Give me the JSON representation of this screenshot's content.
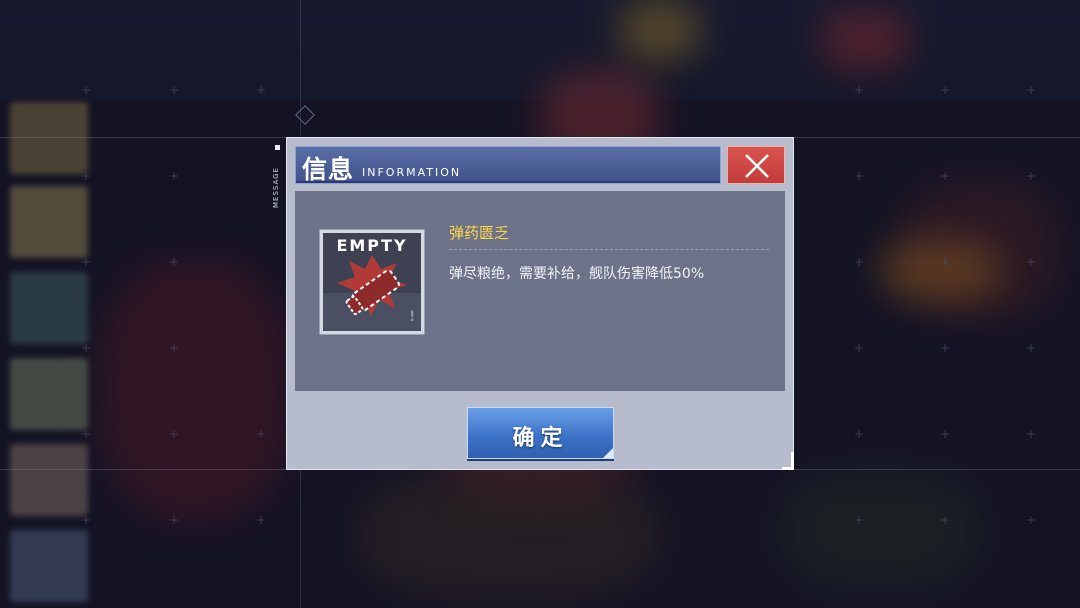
{
  "dialog": {
    "side_label": "MESSAGE",
    "title_cn": "信息",
    "title_en": "INFORMATION",
    "close_icon": "close-icon"
  },
  "item": {
    "icon_label": "EMPTY",
    "icon": "empty-ammo-icon",
    "name": "弹药匮乏",
    "description": "弹尽粮绝，需要补给，舰队伤害降低50%"
  },
  "confirm": {
    "label": "确定"
  },
  "colors": {
    "title_bar": "#4a5d98",
    "close_button": "#d04844",
    "item_name": "#ffd54a",
    "confirm_button": "#3e73c8"
  }
}
